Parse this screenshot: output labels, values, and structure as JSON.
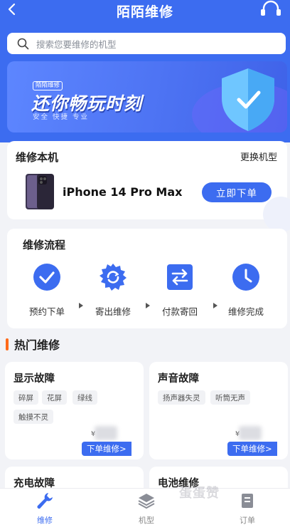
{
  "header": {
    "title": "陌陌维修"
  },
  "search": {
    "placeholder": "搜索您要维修的机型"
  },
  "banner": {
    "tag": "陌陌维修",
    "headline": "还你畅玩时刻",
    "subline": "安全 快捷 专业"
  },
  "repair": {
    "title": "维修本机",
    "change_label": "更换机型",
    "model": "iPhone 14 Pro Max",
    "order_label": "立即下单"
  },
  "process": {
    "title": "维修流程",
    "steps": [
      {
        "label": "预约下单",
        "icon": "check-circle-icon"
      },
      {
        "label": "寄出维修",
        "icon": "sync-gear-icon"
      },
      {
        "label": "付款寄回",
        "icon": "transfer-arrows-icon"
      },
      {
        "label": "维修完成",
        "icon": "clock-icon"
      }
    ]
  },
  "hot": {
    "title": "热门维修",
    "faults": [
      {
        "title": "显示故障",
        "chips": [
          "碎屏",
          "花屏",
          "绿线",
          "触摸不灵"
        ],
        "price_symbol": "¥",
        "button": "下单维修>"
      },
      {
        "title": "声音故障",
        "chips": [
          "扬声器失灵",
          "听筒无声"
        ],
        "price_symbol": "¥",
        "button": "下单维修>"
      },
      {
        "title": "充电故障"
      },
      {
        "title": "电池维修"
      }
    ]
  },
  "tabbar": {
    "items": [
      {
        "label": "维修",
        "icon": "wrench-icon"
      },
      {
        "label": "机型",
        "icon": "layers-icon"
      },
      {
        "label": "订单",
        "icon": "order-icon"
      }
    ]
  },
  "watermark": "蛋蛋赞",
  "colors": {
    "primary": "#3c6cf0",
    "accent": "#ff6a1a",
    "background": "#f2f3f7"
  }
}
